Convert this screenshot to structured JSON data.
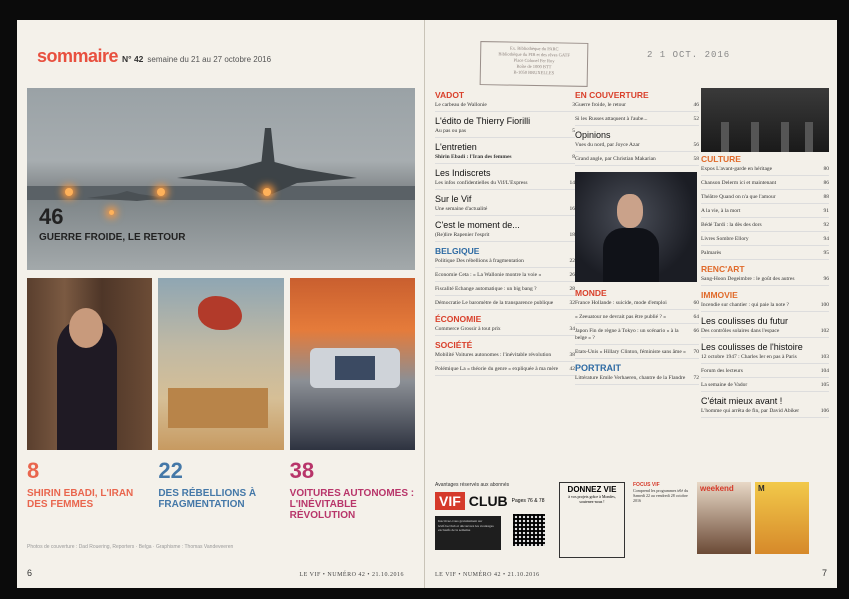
{
  "left": {
    "brand": "sommaire",
    "issue": "N° 42",
    "dates": "semaine du 21 au 27 octobre 2016",
    "hero": {
      "num": "46",
      "caption": "Guerre froide, le retour"
    },
    "stats": [
      {
        "num": "8",
        "title": "Shirin Ebadi, l'Iran des femmes"
      },
      {
        "num": "22",
        "title": "Des rébellions à fragmentation"
      },
      {
        "num": "38",
        "title": "Voitures autonomes : l'inévitable révolution"
      }
    ],
    "credits": "Photos de couverture : Dad Rouering, Reporters · Belga · Graphisme : Thomas Vandeveeren",
    "page_no": "6",
    "footer": "LE VIF • NUMÉRO 42 • 21.10.2016"
  },
  "right": {
    "stamp": [
      "Ex. Bibliothèque du PARC",
      "Bibliothèque du PIB et des rêves GATF",
      "Place Colonel Fer Roy",
      "Boîte de 1000 BTT",
      "B-1050 BRUXELLES"
    ],
    "date_stamp": "2 1 OCT. 2016",
    "col1": [
      {
        "type": "sec",
        "text": "VADOT"
      },
      {
        "type": "item",
        "text": "Le carbeau de Wallonie",
        "p": "3"
      },
      {
        "type": "sub",
        "text": "L'édito de Thierry Fiorilli"
      },
      {
        "type": "item",
        "text": "Au pas ou pas",
        "p": "5"
      },
      {
        "type": "sub",
        "text": "L'entretien"
      },
      {
        "type": "item",
        "text": "Shirin Ebadi : l'Iran des femmes",
        "p": "8",
        "bold": true
      },
      {
        "type": "sub",
        "text": "Les Indiscrets"
      },
      {
        "type": "item",
        "text": "Les infos confidentielles du Vif/L'Express",
        "p": "14"
      },
      {
        "type": "sub",
        "text": "Sur le Vif"
      },
      {
        "type": "item",
        "text": "Une semaine d'actualité",
        "p": "16"
      },
      {
        "type": "sub",
        "text": "C'est le moment de..."
      },
      {
        "type": "item",
        "text": "(Re)lire Rapenier l'esprit",
        "p": "18"
      },
      {
        "type": "sec",
        "text": "BELGIQUE",
        "color": "blue"
      },
      {
        "type": "item",
        "text": "Politique Des rébellions à fragmentation",
        "p": "22"
      },
      {
        "type": "item",
        "text": "Economie Ceta : « La Wallonie montre la voie »",
        "p": "26"
      },
      {
        "type": "item",
        "text": "Fiscalité Echange automatique : un big bang ?",
        "p": "28"
      },
      {
        "type": "item",
        "text": "Démocratie Le baromètre de la transparence publique",
        "p": "32"
      },
      {
        "type": "sec",
        "text": "ÉCONOMIE"
      },
      {
        "type": "item",
        "text": "Commerce Grossir à tout prix",
        "p": "34"
      },
      {
        "type": "sec",
        "text": "SOCIÉTÉ"
      },
      {
        "type": "item",
        "text": "Mobilité Voitures autonomes : l'inévitable révolution",
        "p": "38"
      },
      {
        "type": "item",
        "text": "Polémique La « théorie du genre » expliquée à ma mère",
        "p": "42"
      }
    ],
    "col2": [
      {
        "type": "sec",
        "text": "EN COUVERTURE"
      },
      {
        "type": "item",
        "text": "Guerre froide, le retour",
        "p": "46"
      },
      {
        "type": "item",
        "text": "Si les Russes attaquent à l'aube...",
        "p": "52"
      },
      {
        "type": "sub",
        "text": "Opinions"
      },
      {
        "type": "item",
        "text": "Vues du nord, par Joyce Azar",
        "p": "56"
      },
      {
        "type": "item",
        "text": "Grand angle, par Christian Makarian",
        "p": "58"
      },
      {
        "type": "photo"
      },
      {
        "type": "sec",
        "text": "MONDE"
      },
      {
        "type": "item",
        "text": "France Hollande : suicide, mode d'emploi",
        "p": "60"
      },
      {
        "type": "item",
        "text": "« Zeeuatour ne devrait pas être publié ? »",
        "p": "64"
      },
      {
        "type": "item",
        "text": "Japon Fin de règne à Tokyo : un scénario « à la belge » ?",
        "p": "66"
      },
      {
        "type": "item",
        "text": "Etats-Unis « Hillary Clinton, féministe sans âme »",
        "p": "70"
      },
      {
        "type": "sub",
        "text": "PORTRAIT",
        "color": "blue"
      },
      {
        "type": "item",
        "text": "Littérature Emile Verhaeren, chantre de la Flandre",
        "p": "72"
      }
    ],
    "col3": [
      {
        "type": "photo2"
      },
      {
        "type": "sec",
        "text": "CULTURE",
        "color": "orange"
      },
      {
        "type": "item",
        "text": "Expos L'avant-garde en héritage",
        "p": "80"
      },
      {
        "type": "item",
        "text": "Chanson Delerm ici et maintenant",
        "p": "86"
      },
      {
        "type": "item",
        "text": "Théâtre Quand on n'a que l'amour",
        "p": "88"
      },
      {
        "type": "item",
        "text": "A la vie, à la mort",
        "p": "91"
      },
      {
        "type": "item",
        "text": "Bédé Tardi : la dès des dors",
        "p": "92"
      },
      {
        "type": "item",
        "text": "Livres Sombre Ellory",
        "p": "94"
      },
      {
        "type": "item",
        "text": "Palmarès",
        "p": "95"
      },
      {
        "type": "sec",
        "text": "RENC'ART",
        "color": "orange"
      },
      {
        "type": "item",
        "text": "Sang-Hoon Degeimbre : le goût des autres",
        "p": "96"
      },
      {
        "type": "sec",
        "text": "IMMOVIE",
        "color": "orange"
      },
      {
        "type": "item",
        "text": "Incendie sur chantier : qui paie la note ?",
        "p": "100"
      },
      {
        "type": "sub",
        "text": "Les coulisses du futur"
      },
      {
        "type": "item",
        "text": "Des contrôles solaires dans l'espace",
        "p": "102"
      },
      {
        "type": "sub",
        "text": "Les coulisses de l'histoire"
      },
      {
        "type": "item",
        "text": "12 octobre 1947 : Charles Ier en pas à Paris",
        "p": "103"
      },
      {
        "type": "item",
        "text": "Forum des lecteurs",
        "p": "104"
      },
      {
        "type": "item",
        "text": "La semaine de Vador",
        "p": "105"
      },
      {
        "type": "sub",
        "text": "C'était mieux avant !"
      },
      {
        "type": "item",
        "text": "L'homme qui arrêta de fin, par David Abiker",
        "p": "106"
      }
    ],
    "bottom": {
      "abonnes": "Avantages réservés aux abonnés",
      "vif": "VIF",
      "club": "CLUB",
      "pages": "Pages 76 & 78",
      "dark_text": "Inscrivez-vous gratuitement sur levif.be/club et découvrez les avantages exclusifs de la semaine",
      "donnez_title": "DONNEZ VIE",
      "donnez_sub": "à vos projets grâce à Mondes, soutenez-nous !",
      "focus_title": "FOCUS VIF",
      "focus_text": "Comprend les programmes télé du Samedi 22 au vendredi 28 octobre 2016",
      "cover1": "weekend",
      "cover2": "M"
    },
    "footer": "LE VIF • NUMÉRO 42 • 21.10.2016",
    "page_no": "7"
  }
}
